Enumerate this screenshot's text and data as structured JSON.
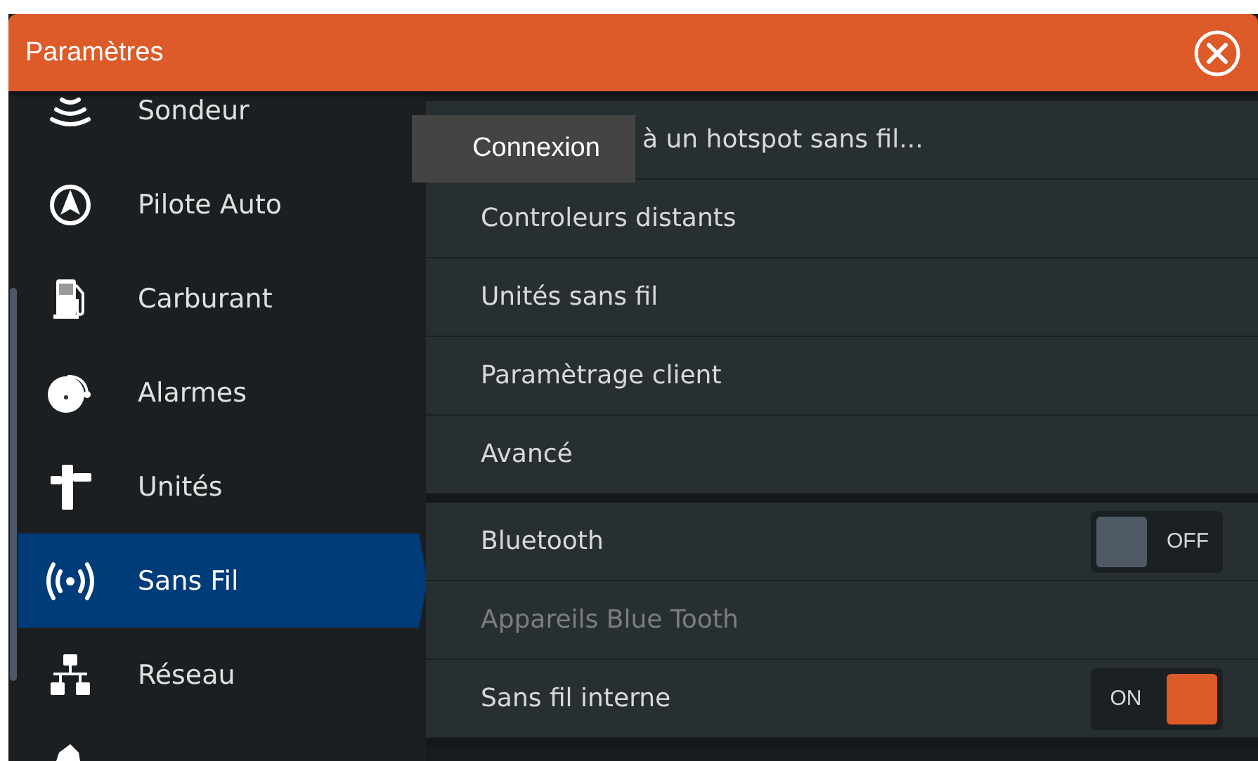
{
  "window": {
    "title": "Paramètres"
  },
  "sidebar": {
    "items": [
      {
        "kind": "sonar",
        "label": "Sondeur",
        "selected": false
      },
      {
        "kind": "autopilot",
        "label": "Pilote Auto",
        "selected": false
      },
      {
        "kind": "fuel",
        "label": "Carburant",
        "selected": false
      },
      {
        "kind": "alarm",
        "label": "Alarmes",
        "selected": false
      },
      {
        "kind": "units",
        "label": "Unités",
        "selected": false
      },
      {
        "kind": "wireless",
        "label": "Sans Fil",
        "selected": true
      },
      {
        "kind": "network",
        "label": "Réseau",
        "selected": false
      },
      {
        "kind": "vessel",
        "selected": false
      }
    ]
  },
  "settings": {
    "groups": [
      {
        "rows": [
          {
            "label": "à un hotspot sans fil...",
            "kind": "link",
            "disabled": false
          },
          {
            "label": "Controleurs distants",
            "kind": "link",
            "disabled": false
          },
          {
            "label": "Unités sans fil",
            "kind": "link",
            "disabled": false
          },
          {
            "label": "Paramètrage client",
            "kind": "link",
            "disabled": false
          },
          {
            "label": "Avancé",
            "kind": "link",
            "disabled": false
          }
        ]
      },
      {
        "rows": [
          {
            "label": "Bluetooth",
            "kind": "toggle",
            "on": false,
            "state_text": "OFF",
            "disabled": false
          },
          {
            "label": "Appareils Blue Tooth",
            "kind": "link",
            "disabled": true
          },
          {
            "label": "Sans fil interne",
            "kind": "toggle",
            "on": true,
            "state_text": "ON",
            "disabled": false
          }
        ]
      }
    ]
  },
  "tooltip": {
    "text": "Connexion"
  }
}
